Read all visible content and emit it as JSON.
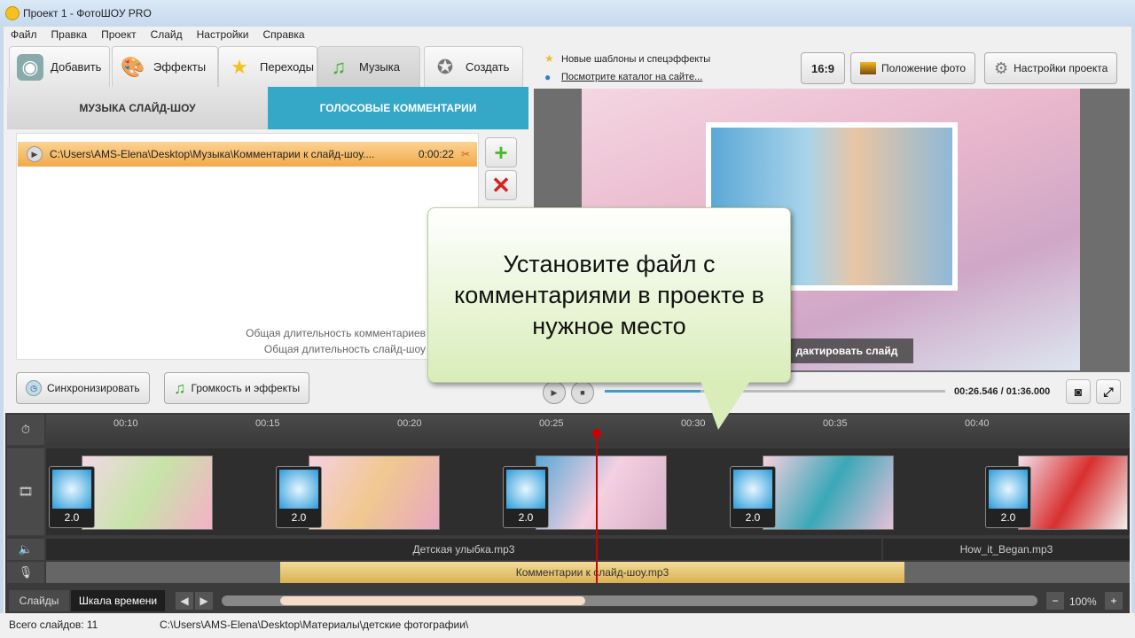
{
  "window": {
    "title": "Проект 1 - ФотоШОУ PRO"
  },
  "menu": [
    "Файл",
    "Правка",
    "Проект",
    "Слайд",
    "Настройки",
    "Справка"
  ],
  "tabs": [
    {
      "label": "Добавить"
    },
    {
      "label": "Эффекты"
    },
    {
      "label": "Переходы"
    },
    {
      "label": "Музыка"
    },
    {
      "label": "Создать"
    }
  ],
  "subtabs": {
    "music": "МУЗЫКА СЛАЙД-ШОУ",
    "voice": "ГОЛОСОВЫЕ КОММЕНТАРИИ"
  },
  "comment_file": {
    "path": "C:\\Users\\AMS-Elena\\Desktop\\Музыка\\Комментарии к слайд-шоу....",
    "duration": "0:00:22"
  },
  "durations": {
    "comments": "Общая длительность комментариев",
    "slideshow": "Общая длительность слайд-шоу"
  },
  "buttons": {
    "sync": "Синхронизировать",
    "volume": "Громкость и эффекты",
    "ratio": "16:9",
    "photo_pos": "Положение фото",
    "project_settings": "Настройки проекта",
    "edit_slide": "дактировать слайд"
  },
  "promo": {
    "new": "Новые шаблоны и спецэффекты",
    "catalog": "Посмотрите каталог на сайте..."
  },
  "player": {
    "time": "00:26.546 / 01:36.000",
    "progress": 0.28
  },
  "callout": "Установите файл с комментариями в проекте в нужное место",
  "ruler": [
    "00:10",
    "00:15",
    "00:20",
    "00:25",
    "00:30",
    "00:35",
    "00:40"
  ],
  "transitions": [
    "2.0",
    "2.0",
    "2.0",
    "2.0",
    "2.0"
  ],
  "tracks": {
    "music1": "Детская улыбка.mp3",
    "music2": "How_it_Began.mp3",
    "voice": "Комментарии к слайд-шоу.mp3"
  },
  "bottom": {
    "slides": "Слайды",
    "timeline": "Шкала времени",
    "zoom": "100%"
  },
  "status": {
    "count": "Всего слайдов: 11",
    "path": "C:\\Users\\AMS-Elena\\Desktop\\Материалы\\детские фотографии\\"
  }
}
